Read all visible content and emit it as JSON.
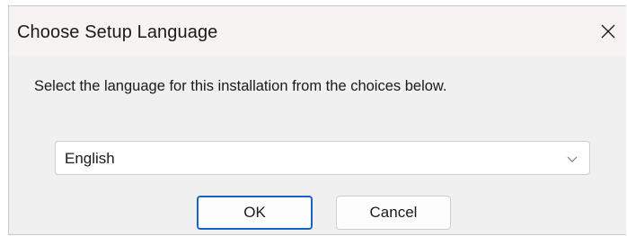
{
  "dialog": {
    "title": "Choose Setup Language",
    "close_glyph": "✕",
    "prompt": "Select the language for this installation from the choices below.",
    "language_select": {
      "selected": "English",
      "icon": "chevron-down-icon"
    },
    "buttons": {
      "ok_label": "OK",
      "cancel_label": "Cancel"
    }
  },
  "colors": {
    "titlebar_bg": "#f7f3f2",
    "body_bg": "#f0f0f0",
    "ok_border_accent": "#1a62c8"
  }
}
